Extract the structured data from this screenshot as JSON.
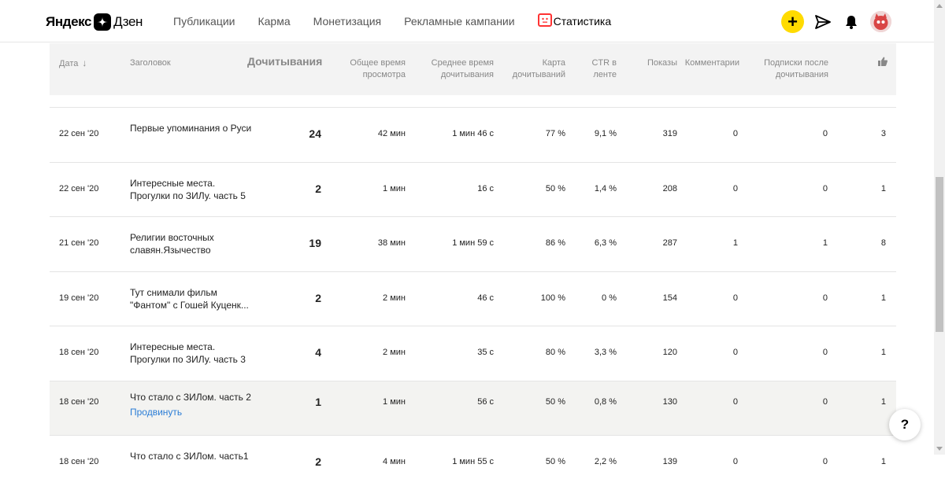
{
  "brand": {
    "name_bold": "Яндекс",
    "name_light": "Дзен"
  },
  "nav": [
    {
      "label": "Публикации",
      "active": false
    },
    {
      "label": "Карма",
      "active": false
    },
    {
      "label": "Монетизация",
      "active": false
    },
    {
      "label": "Рекламные кампании",
      "active": false
    },
    {
      "label": "Статистика",
      "active": true
    }
  ],
  "header_icons": {
    "create": "+",
    "send": "paper-plane-icon",
    "notifications": "bell-icon",
    "avatar": "avatar"
  },
  "columns": {
    "date": "Дата",
    "title": "Заголовок",
    "reads": "Дочитывания",
    "total_time": "Общее время просмотра",
    "avg_time": "Среднее время дочитывания",
    "read_map": "Карта дочитываний",
    "ctr": "CTR в ленте",
    "views": "Показы",
    "comments": "Комментарии",
    "subs": "Подписки после дочитывания",
    "likes": "thumbs-up-icon"
  },
  "rows": [
    {
      "date": "22 сен '20",
      "title": "Первые упоминания о Руси",
      "reads": "24",
      "total_time": "42 мин",
      "avg_time": "1 мин 46 с",
      "read_map": "77 %",
      "ctr": "9,1 %",
      "views": "319",
      "comments": "0",
      "subs": "0",
      "likes": "3",
      "promote": ""
    },
    {
      "date": "22 сен '20",
      "title": "Интересные места. Прогулки по ЗИЛу. часть 5",
      "reads": "2",
      "total_time": "1 мин",
      "avg_time": "16 с",
      "read_map": "50 %",
      "ctr": "1,4 %",
      "views": "208",
      "comments": "0",
      "subs": "0",
      "likes": "1",
      "promote": ""
    },
    {
      "date": "21 сен '20",
      "title": "Религии восточных славян.Язычество",
      "reads": "19",
      "total_time": "38 мин",
      "avg_time": "1 мин 59 с",
      "read_map": "86 %",
      "ctr": "6,3 %",
      "views": "287",
      "comments": "1",
      "subs": "1",
      "likes": "8",
      "promote": ""
    },
    {
      "date": "19 сен '20",
      "title": "Тут снимали фильм \"Фантом\" с Гошей Куценк...",
      "reads": "2",
      "total_time": "2 мин",
      "avg_time": "46 с",
      "read_map": "100 %",
      "ctr": "0 %",
      "views": "154",
      "comments": "0",
      "subs": "0",
      "likes": "1",
      "promote": ""
    },
    {
      "date": "18 сен '20",
      "title": "Интересные места. Прогулки по ЗИЛу. часть 3",
      "reads": "4",
      "total_time": "2 мин",
      "avg_time": "35 с",
      "read_map": "80 %",
      "ctr": "3,3 %",
      "views": "120",
      "comments": "0",
      "subs": "0",
      "likes": "1",
      "promote": ""
    },
    {
      "date": "18 сен '20",
      "title": "Что стало с ЗИЛом. часть 2",
      "reads": "1",
      "total_time": "1 мин",
      "avg_time": "56 с",
      "read_map": "50 %",
      "ctr": "0,8 %",
      "views": "130",
      "comments": "0",
      "subs": "0",
      "likes": "1",
      "promote": "Продвинуть"
    },
    {
      "date": "18 сен '20",
      "title": "Что стало с ЗИЛом. часть1",
      "reads": "2",
      "total_time": "4 мин",
      "avg_time": "1 мин 55 с",
      "read_map": "50 %",
      "ctr": "2,2 %",
      "views": "139",
      "comments": "0",
      "subs": "0",
      "likes": "1",
      "promote": ""
    }
  ],
  "help": "?"
}
